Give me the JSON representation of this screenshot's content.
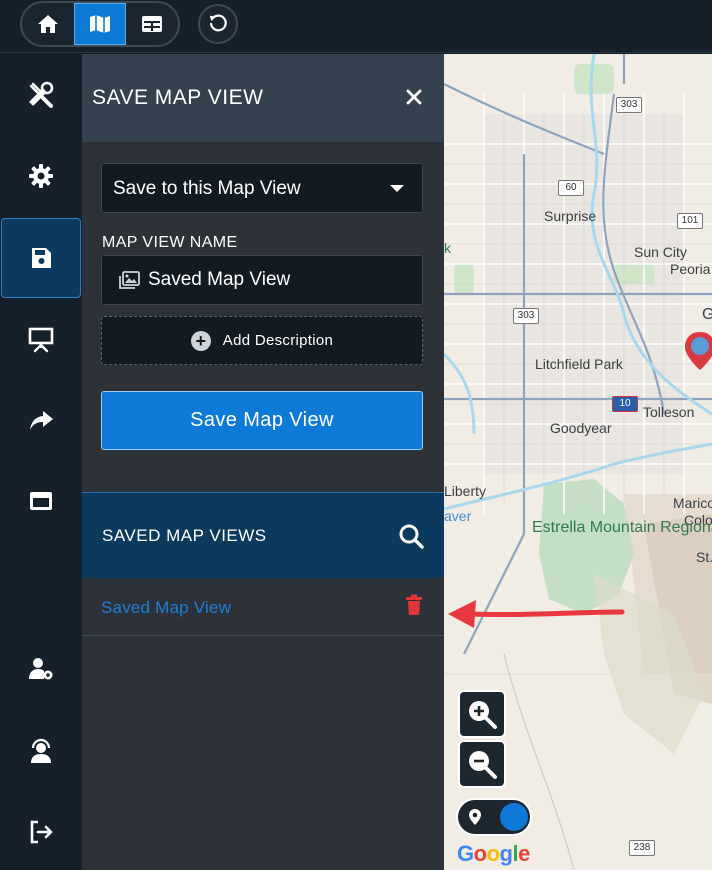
{
  "topbar": {
    "buttons": [
      {
        "icon": "home-icon",
        "active": false
      },
      {
        "icon": "map-icon",
        "active": true
      },
      {
        "icon": "table-icon",
        "active": false
      }
    ],
    "reset_icon": "refresh-icon"
  },
  "rail": {
    "items": [
      {
        "icon": "tools-icon"
      },
      {
        "icon": "gear-icon"
      },
      {
        "icon": "save-icon",
        "active": true
      },
      {
        "icon": "presentation-icon"
      },
      {
        "icon": "share-icon"
      },
      {
        "icon": "window-icon"
      },
      {
        "icon": "user-gear-icon"
      },
      {
        "icon": "support-icon"
      },
      {
        "icon": "logout-icon"
      }
    ]
  },
  "panel": {
    "title": "SAVE MAP VIEW",
    "select_value": "Save to this Map View",
    "name_label": "MAP VIEW NAME",
    "name_value": "Saved Map View",
    "add_description": "Add Description",
    "save_button": "Save Map View",
    "saved_header": "SAVED MAP VIEWS",
    "saved_items": [
      {
        "name": "Saved Map View"
      }
    ]
  },
  "map": {
    "labels": {
      "surprise": "Surprise",
      "sun_city": "Sun City",
      "peoria": "Peoria",
      "litchfield": "Litchfield Park",
      "tolleson": "Tolleson",
      "goodyear": "Goodyear",
      "liberty": "Liberty",
      "maricopa": "Marico",
      "colo": "Colo",
      "st": "St.",
      "estrella": "Estrella Mountain Regional Park",
      "g": "G",
      "k": "k",
      "aver": "aver"
    },
    "shields": [
      "303",
      "60",
      "101",
      "303",
      "10",
      "238"
    ],
    "attribution": "Google"
  },
  "colors": {
    "accent": "#0c7ad6",
    "delete": "#e0353b",
    "annotation_arrow": "#e8373f"
  }
}
